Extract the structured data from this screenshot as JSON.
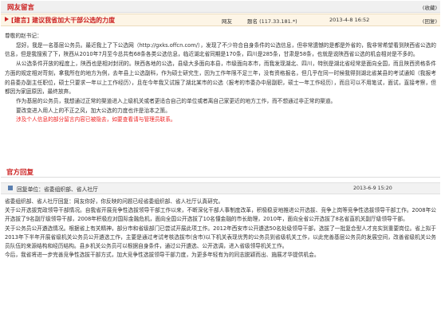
{
  "header": {
    "title": "网友留言",
    "fav_label": "(收藏)"
  },
  "message": {
    "subject": "[建言] 建议我省加大干部公选的力度",
    "author_role": "网友",
    "ip": "题名 (117.33.181.*)",
    "time": "2013-4-8 16:52",
    "reply_label": "(回复)",
    "greeting": "尊敬的赵书记：",
    "paragraphs": [
      "您好。我是一名基层公务员。最近我上了下公选网（http://gxks.offcn.com/），发现了不少符合自身条件的公选信息，但非常遗憾的是都是外省的，我非常希望看到陕西省公选的信息，但是我搜索了下，陕西从2010年7月至今总共有68条各类公选信息，临近湖北省同期是170条，四川是285条，甘肃是58条，也就是说陕西省公选的机会相对是不多的。",
      "从公选条件开放的程度上，陕西也是相对封闭的。陕西各地的公选，县级大多面向本县，市级面向本市，而我发现湖北、四川，特别是湖北省经常是面向全国，而且陕西资格条件方面的规定相对苛刻，拿我所在的地方为例，去年县上公选副科，作为硕士研究生，因为工作年限不足三年，没有资格报名，但几乎在同一时候我得到湖北省某县的考试通知（我报考的县委办副主任职位，硕士只要求一年以上工作经历），且在今年我又试报了湖北某市的公选（报考的市委办中层副职，硕士一年工作经历），而且可以不用笔试，面试，直接考察，但都因为家庭原因，最终放弃。",
      "作为基层的公务员，我想通过正常的渠道进入上级机关或者更适合自己的单位或者离自己家更近的地方工作，而不想通过非正常的渠道。",
      "要改变进入用人上的不正之风，加大公选的力度也许是治本之策。"
    ],
    "notice": "涉及个人信息的部分留言内容已被隐去，如要查看请与管理员联系。"
  },
  "official_reply": {
    "section_title": "官方回复",
    "title": "回复单位：省委组织部、省人社厅",
    "time": "2013-6-9 15:20",
    "paragraphs": [
      "省委组织部、省人社厅回复：网友你好，你反映的问题已经省委组织部、省人社厅认真研究。",
      "关于公开选拔党政领导干部情况。自我省开展竞争性选拔领导干部工作以来，不断深化干部人事制度改革，积极稳妥地推进公开选拔、竞争上岗等竞争性选拔领导干部工作。2008年公开选拔了9名副厅级领导干部，2008年积极应对国际金融危机，面向全国公开选拔了10名懂金融的市长助理，2010年，面向全省公开选拔了8名省直机关副厅级领导干部。",
      "关于公务员公开遴选情况。根据省上有关精神，部分市和省级部门已尝试开展此项工作。2012年西安市公开遴选50名处级领导干部，选拔了一批复合型人才充实到重要岗位。省上拟于2013年下半年开展省级机关公务员公开遴选工作，主要是通过考试考核选拔市(含市)以下机关表现优秀的公务员到省级机关工作，以此完善基层公务员的发展空间，改善省级机关公务员队伍的来源结构和经历结构。县乡机关公务员可以根据自身条件，通过公开遴选、公开选调，进入省级领导机关工作。",
      "今后，我省将进一步完善竞争性选拔干部方式，加大竞争性选拔领导干部力度，为更多年轻有为的同志脱颖而出、施展才华提供机会。"
    ]
  }
}
